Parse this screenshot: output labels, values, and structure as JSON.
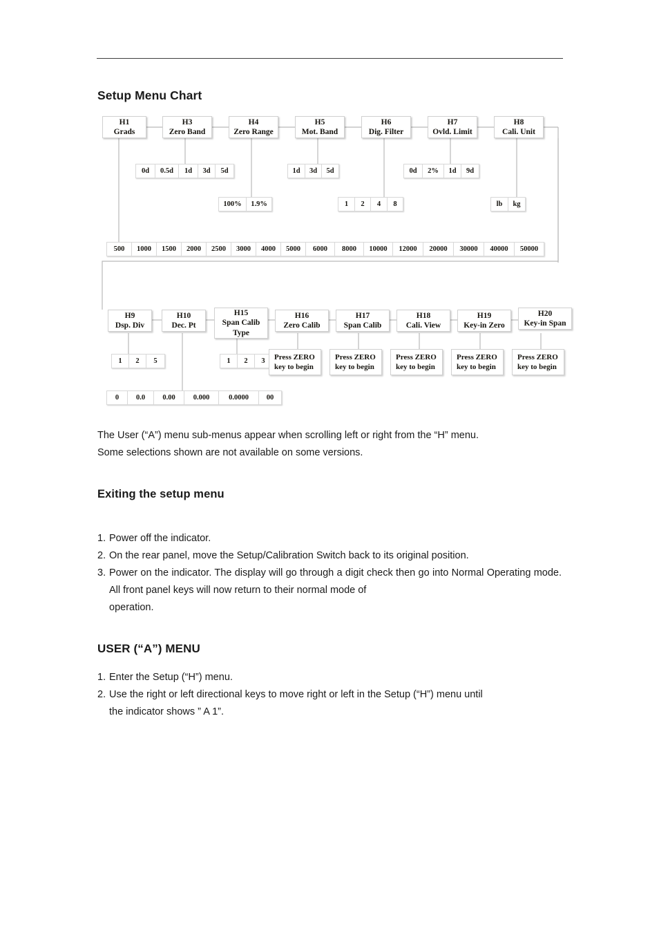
{
  "document": {
    "section_title": "Setup Menu Chart",
    "exiting_title": "Exiting the setup menu",
    "user_menu_title": "USER (“A”) MENU"
  },
  "chart_data": {
    "type": "diagram",
    "title": "Setup Menu Chart",
    "description": "Hierarchical setup menu flow chart with H-code parameter nodes and their selectable option values.",
    "rows": [
      {
        "row": 1,
        "nodes": [
          {
            "id": "H1",
            "label": "Grads",
            "options": [
              "500",
              "1000",
              "1500",
              "2000",
              "2500",
              "3000",
              "4000",
              "5000",
              "6000",
              "8000",
              "10000",
              "12000",
              "20000",
              "30000",
              "40000",
              "50000"
            ]
          },
          {
            "id": "H3",
            "label": "Zero Band",
            "options": [
              "0d",
              "0.5d",
              "1d",
              "3d",
              "5d"
            ]
          },
          {
            "id": "H4",
            "label": "Zero Range",
            "options": [
              "100%",
              "1.9%"
            ]
          },
          {
            "id": "H5",
            "label": "Mot. Band",
            "options": [
              "1d",
              "3d",
              "5d"
            ]
          },
          {
            "id": "H6",
            "label": "Dig. Filter",
            "options": [
              "1",
              "2",
              "4",
              "8"
            ]
          },
          {
            "id": "H7",
            "label": "Ovld. Limit",
            "options": [
              "0d",
              "2%",
              "1d",
              "9d"
            ]
          },
          {
            "id": "H8",
            "label": "Cali. Unit",
            "options": [
              "lb",
              "kg"
            ]
          }
        ]
      },
      {
        "row": 2,
        "nodes": [
          {
            "id": "H9",
            "label": "Dsp. Div",
            "options": [
              "1",
              "2",
              "5"
            ]
          },
          {
            "id": "H10",
            "label": "Dec. Pt",
            "options": [
              "0",
              "0.0",
              "0.00",
              "0.000",
              "0.0000",
              "00"
            ]
          },
          {
            "id": "H15",
            "label": "Span Calib Type",
            "label_line1": "Span Calib",
            "label_line2": "Type",
            "options": [
              "1",
              "2",
              "3"
            ]
          },
          {
            "id": "H16",
            "label": "Zero Calib",
            "options": [
              "Press ZERO key to begin"
            ]
          },
          {
            "id": "H17",
            "label": "Span Calib",
            "options": [
              "Press ZERO key to begin"
            ]
          },
          {
            "id": "H18",
            "label": "Cali. View",
            "options": [
              "Press ZERO key to begin"
            ]
          },
          {
            "id": "H19",
            "label": "Key-in Zero",
            "options": [
              "Press ZERO key to begin"
            ]
          },
          {
            "id": "H20",
            "label": "Key-in Span",
            "options": [
              "Press ZERO key to begin"
            ]
          }
        ]
      }
    ],
    "press_prompt_line1": "Press ZERO",
    "press_prompt_line2": "key to begin"
  },
  "nodes": {
    "h1_id": "H1",
    "h1_label": "Grads",
    "h3_id": "H3",
    "h3_label": "Zero Band",
    "h4_id": "H4",
    "h4_label": "Zero Range",
    "h5_id": "H5",
    "h5_label": "Mot. Band",
    "h6_id": "H6",
    "h6_label": "Dig. Filter",
    "h7_id": "H7",
    "h7_label": "Ovld. Limit",
    "h8_id": "H8",
    "h8_label": "Cali. Unit",
    "h9_id": "H9",
    "h9_label": "Dsp. Div",
    "h10_id": "H10",
    "h10_label": "Dec. Pt",
    "h15_id": "H15",
    "h15_label1": "Span Calib",
    "h15_label2": "Type",
    "h16_id": "H16",
    "h16_label": "Zero Calib",
    "h17_id": "H17",
    "h17_label": "Span Calib",
    "h18_id": "H18",
    "h18_label": "Cali. View",
    "h19_id": "H19",
    "h19_label": "Key-in Zero",
    "h20_id": "H20",
    "h20_label": "Key-in Span"
  },
  "options": {
    "zero_band": [
      "0d",
      "0.5d",
      "1d",
      "3d",
      "5d"
    ],
    "mot_band": [
      "1d",
      "3d",
      "5d"
    ],
    "ovld_limit": [
      "0d",
      "2%",
      "1d",
      "9d"
    ],
    "zero_range": [
      "100%",
      "1.9%"
    ],
    "dig_filter": [
      "1",
      "2",
      "4",
      "8"
    ],
    "cali_unit": [
      "lb",
      "kg"
    ],
    "grads": [
      "500",
      "1000",
      "1500",
      "2000",
      "2500",
      "3000",
      "4000",
      "5000",
      "6000",
      "8000",
      "10000",
      "12000",
      "20000",
      "30000",
      "40000",
      "50000"
    ],
    "dsp_div": [
      "1",
      "2",
      "5"
    ],
    "span_calib_type": [
      "1",
      "2",
      "3"
    ],
    "dec_pt": [
      "0",
      "0.0",
      "0.00",
      "0.000",
      "0.0000",
      "00"
    ]
  },
  "press": {
    "line1": "Press ZERO",
    "line2": "key to begin"
  },
  "body": {
    "note_line1": "The User (“A”) menu sub-menus appear when scrolling left or right from the “H” menu.",
    "note_line2": "Some selections shown are not available on some versions.",
    "exit_1_num": "1.",
    "exit_1_text": "Power off the indicator.",
    "exit_2_num": "2.",
    "exit_2_text": "On the rear panel, move the Setup/Calibration Switch back to its original position.",
    "exit_3_num": "3.",
    "exit_3_text": "Power on the indicator. The display will go through a digit check then go into Normal Operating mode. All front panel keys will now return to their normal mode of",
    "exit_3_lastline": "operation.",
    "user_1_num": "1.",
    "user_1_text": "Enter the Setup (“H”) menu.",
    "user_2_num": "2.",
    "user_2_text": "Use the right or left directional keys to move right or left in the Setup (“H”) menu until",
    "user_2_lastline": "the indicator shows ” A 1”."
  }
}
